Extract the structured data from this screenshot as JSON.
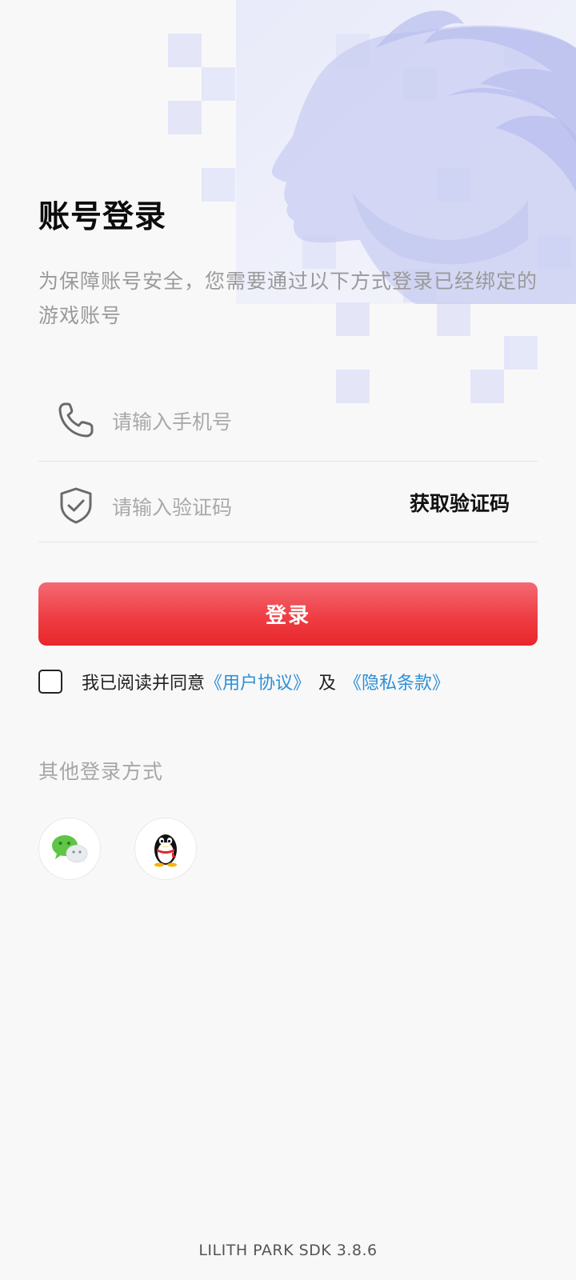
{
  "header": {
    "title": "账号登录",
    "subtitle": "为保障账号安全，您需要通过以下方式登录已经绑定的游戏账号"
  },
  "form": {
    "phone": {
      "placeholder": "请输入手机号",
      "value": "",
      "icon": "phone-icon"
    },
    "code": {
      "placeholder": "请输入验证码",
      "value": "",
      "icon": "shield-check-icon",
      "get_code_label": "获取验证码"
    },
    "login_label": "登录"
  },
  "agreement": {
    "checked": false,
    "prefix": "我已阅读并同意",
    "user_agreement": "《用户协议》",
    "and": "及",
    "privacy_policy": "《隐私条款》"
  },
  "other_login": {
    "label": "其他登录方式",
    "options": [
      {
        "name": "WeChat",
        "icon": "wechat-icon"
      },
      {
        "name": "QQ",
        "icon": "qq-icon"
      }
    ]
  },
  "footer": {
    "version": "LILITH PARK SDK 3.8.6"
  },
  "colors": {
    "background": "#f8f8f8",
    "primary_button": "#ee3e44",
    "link": "#2c8fd8",
    "placeholder": "#a9a9a9",
    "muted_text": "#9a9a9a",
    "art_tint": "#c9cdf2"
  }
}
